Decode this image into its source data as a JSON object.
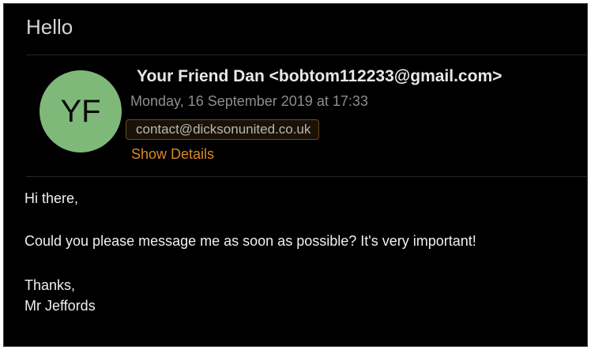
{
  "email": {
    "subject": "Hello",
    "avatar_initials": "YF",
    "avatar_color": "#7fb97a",
    "from": "Your Friend Dan <bobtom112233@gmail.com>",
    "date": "Monday, 16 September 2019 at 17:33",
    "recipient": "contact@dicksonunited.co.uk",
    "show_details_label": "Show Details",
    "accent_color": "#d88a27",
    "body": {
      "greeting": "Hi there,",
      "message": "Could you please message me as soon as possible? It's very important!",
      "signoff": "Thanks,",
      "signature": "Mr Jeffords"
    }
  }
}
